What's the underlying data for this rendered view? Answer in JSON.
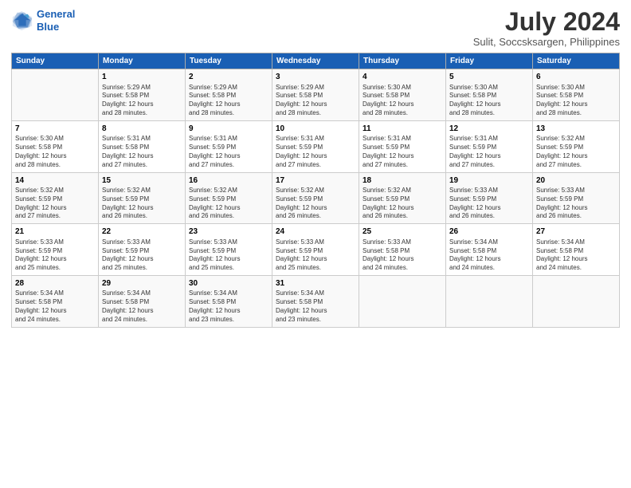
{
  "logo": {
    "line1": "General",
    "line2": "Blue"
  },
  "title": "July 2024",
  "subtitle": "Sulit, Soccsksargen, Philippines",
  "days_header": [
    "Sunday",
    "Monday",
    "Tuesday",
    "Wednesday",
    "Thursday",
    "Friday",
    "Saturday"
  ],
  "weeks": [
    [
      {
        "num": "",
        "info": ""
      },
      {
        "num": "1",
        "info": "Sunrise: 5:29 AM\nSunset: 5:58 PM\nDaylight: 12 hours\nand 28 minutes."
      },
      {
        "num": "2",
        "info": "Sunrise: 5:29 AM\nSunset: 5:58 PM\nDaylight: 12 hours\nand 28 minutes."
      },
      {
        "num": "3",
        "info": "Sunrise: 5:29 AM\nSunset: 5:58 PM\nDaylight: 12 hours\nand 28 minutes."
      },
      {
        "num": "4",
        "info": "Sunrise: 5:30 AM\nSunset: 5:58 PM\nDaylight: 12 hours\nand 28 minutes."
      },
      {
        "num": "5",
        "info": "Sunrise: 5:30 AM\nSunset: 5:58 PM\nDaylight: 12 hours\nand 28 minutes."
      },
      {
        "num": "6",
        "info": "Sunrise: 5:30 AM\nSunset: 5:58 PM\nDaylight: 12 hours\nand 28 minutes."
      }
    ],
    [
      {
        "num": "7",
        "info": "Sunrise: 5:30 AM\nSunset: 5:58 PM\nDaylight: 12 hours\nand 28 minutes."
      },
      {
        "num": "8",
        "info": "Sunrise: 5:31 AM\nSunset: 5:58 PM\nDaylight: 12 hours\nand 27 minutes."
      },
      {
        "num": "9",
        "info": "Sunrise: 5:31 AM\nSunset: 5:59 PM\nDaylight: 12 hours\nand 27 minutes."
      },
      {
        "num": "10",
        "info": "Sunrise: 5:31 AM\nSunset: 5:59 PM\nDaylight: 12 hours\nand 27 minutes."
      },
      {
        "num": "11",
        "info": "Sunrise: 5:31 AM\nSunset: 5:59 PM\nDaylight: 12 hours\nand 27 minutes."
      },
      {
        "num": "12",
        "info": "Sunrise: 5:31 AM\nSunset: 5:59 PM\nDaylight: 12 hours\nand 27 minutes."
      },
      {
        "num": "13",
        "info": "Sunrise: 5:32 AM\nSunset: 5:59 PM\nDaylight: 12 hours\nand 27 minutes."
      }
    ],
    [
      {
        "num": "14",
        "info": "Sunrise: 5:32 AM\nSunset: 5:59 PM\nDaylight: 12 hours\nand 27 minutes."
      },
      {
        "num": "15",
        "info": "Sunrise: 5:32 AM\nSunset: 5:59 PM\nDaylight: 12 hours\nand 26 minutes."
      },
      {
        "num": "16",
        "info": "Sunrise: 5:32 AM\nSunset: 5:59 PM\nDaylight: 12 hours\nand 26 minutes."
      },
      {
        "num": "17",
        "info": "Sunrise: 5:32 AM\nSunset: 5:59 PM\nDaylight: 12 hours\nand 26 minutes."
      },
      {
        "num": "18",
        "info": "Sunrise: 5:32 AM\nSunset: 5:59 PM\nDaylight: 12 hours\nand 26 minutes."
      },
      {
        "num": "19",
        "info": "Sunrise: 5:33 AM\nSunset: 5:59 PM\nDaylight: 12 hours\nand 26 minutes."
      },
      {
        "num": "20",
        "info": "Sunrise: 5:33 AM\nSunset: 5:59 PM\nDaylight: 12 hours\nand 26 minutes."
      }
    ],
    [
      {
        "num": "21",
        "info": "Sunrise: 5:33 AM\nSunset: 5:59 PM\nDaylight: 12 hours\nand 25 minutes."
      },
      {
        "num": "22",
        "info": "Sunrise: 5:33 AM\nSunset: 5:59 PM\nDaylight: 12 hours\nand 25 minutes."
      },
      {
        "num": "23",
        "info": "Sunrise: 5:33 AM\nSunset: 5:59 PM\nDaylight: 12 hours\nand 25 minutes."
      },
      {
        "num": "24",
        "info": "Sunrise: 5:33 AM\nSunset: 5:59 PM\nDaylight: 12 hours\nand 25 minutes."
      },
      {
        "num": "25",
        "info": "Sunrise: 5:33 AM\nSunset: 5:58 PM\nDaylight: 12 hours\nand 24 minutes."
      },
      {
        "num": "26",
        "info": "Sunrise: 5:34 AM\nSunset: 5:58 PM\nDaylight: 12 hours\nand 24 minutes."
      },
      {
        "num": "27",
        "info": "Sunrise: 5:34 AM\nSunset: 5:58 PM\nDaylight: 12 hours\nand 24 minutes."
      }
    ],
    [
      {
        "num": "28",
        "info": "Sunrise: 5:34 AM\nSunset: 5:58 PM\nDaylight: 12 hours\nand 24 minutes."
      },
      {
        "num": "29",
        "info": "Sunrise: 5:34 AM\nSunset: 5:58 PM\nDaylight: 12 hours\nand 24 minutes."
      },
      {
        "num": "30",
        "info": "Sunrise: 5:34 AM\nSunset: 5:58 PM\nDaylight: 12 hours\nand 23 minutes."
      },
      {
        "num": "31",
        "info": "Sunrise: 5:34 AM\nSunset: 5:58 PM\nDaylight: 12 hours\nand 23 minutes."
      },
      {
        "num": "",
        "info": ""
      },
      {
        "num": "",
        "info": ""
      },
      {
        "num": "",
        "info": ""
      }
    ]
  ]
}
